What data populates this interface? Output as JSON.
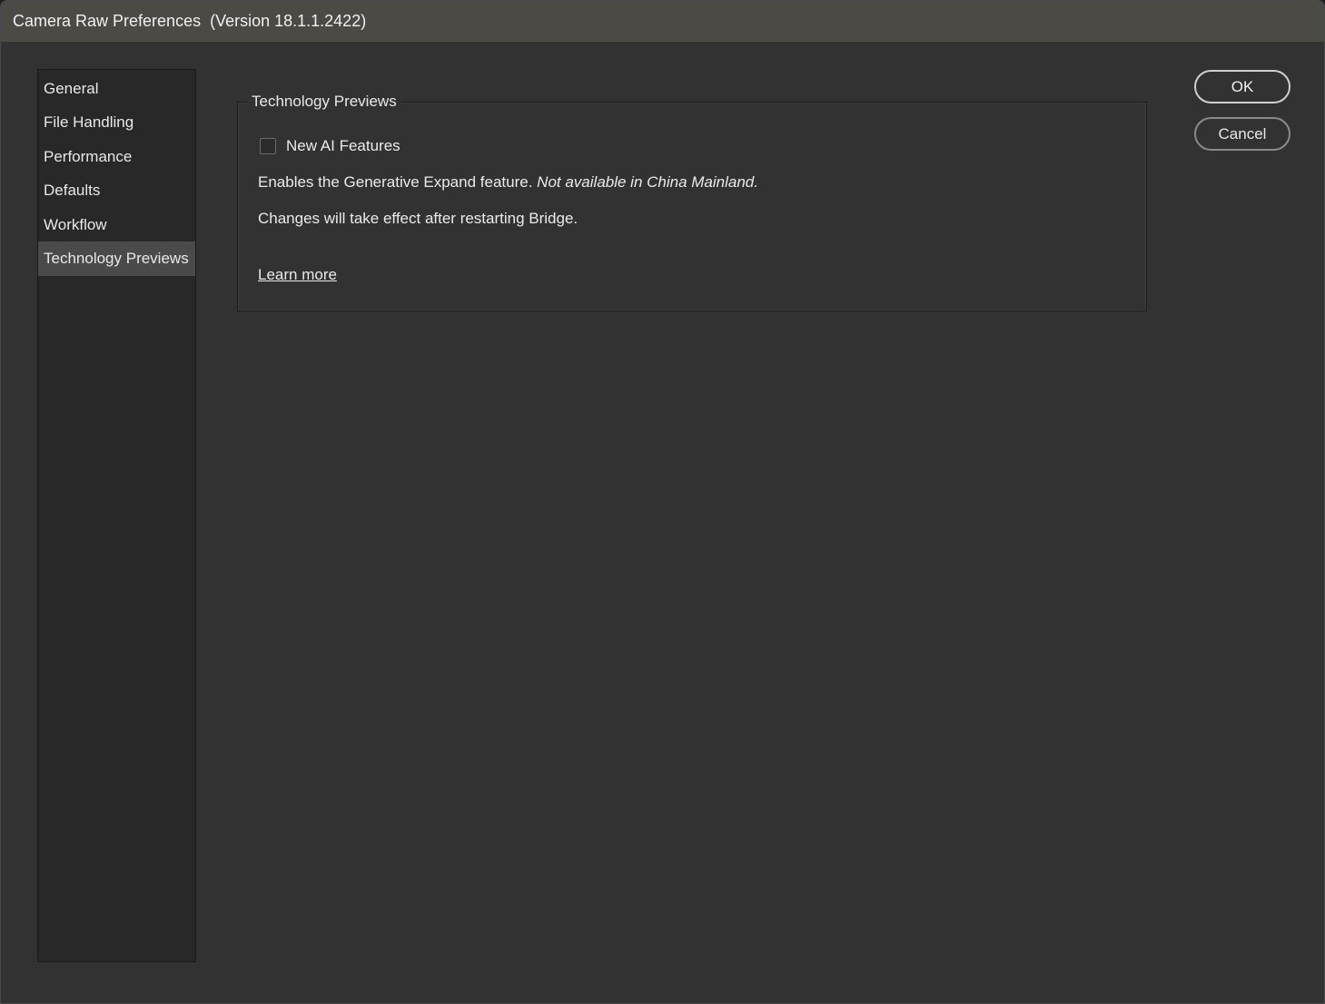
{
  "window": {
    "title": "Camera Raw Preferences  (Version 18.1.1.2422)"
  },
  "sidebar": {
    "items": [
      {
        "label": "General",
        "selected": false
      },
      {
        "label": "File Handling",
        "selected": false
      },
      {
        "label": "Performance",
        "selected": false
      },
      {
        "label": "Defaults",
        "selected": false
      },
      {
        "label": "Workflow",
        "selected": false
      },
      {
        "label": "Technology Previews",
        "selected": true
      }
    ]
  },
  "panel": {
    "group_title": "Technology Previews",
    "checkbox_label": "New AI Features",
    "checkbox_checked": false,
    "description": "Enables the Generative Expand feature.",
    "description_note": "Not available in China Mainland.",
    "restart_note": "Changes will take effect after restarting Bridge.",
    "learn_more": "Learn more"
  },
  "buttons": {
    "ok": "OK",
    "cancel": "Cancel"
  },
  "colors": {
    "window_bg": "#323232",
    "titlebar_bg": "#4b4a45",
    "sidebar_bg": "#282828",
    "selected_bg": "#4a4a4a",
    "text": "#eaeaea"
  }
}
